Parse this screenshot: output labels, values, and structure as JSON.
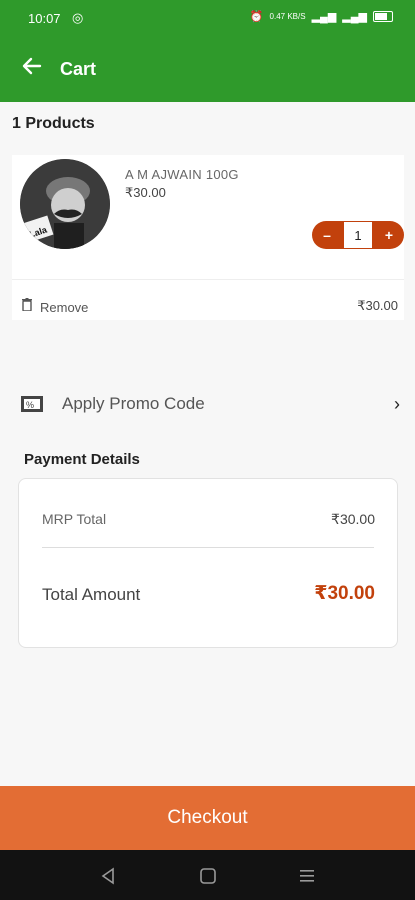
{
  "status_bar": {
    "time": "10:07",
    "net_speed": "0.47 KB/S"
  },
  "app_bar": {
    "title": "Cart",
    "back_icon": "arrow-left-icon"
  },
  "cart": {
    "products_count": "1 Products"
  },
  "product": {
    "name": "A M AJWAIN 100G",
    "price": "₹30.00",
    "quantity": "1",
    "minus": "–",
    "plus": "+",
    "remove_label": "Remove",
    "line_total": "₹30.00",
    "brand_logo": "Lala"
  },
  "promo": {
    "label": "Apply Promo Code",
    "icon": "promo-code-icon"
  },
  "payment": {
    "title": "Payment Details",
    "mrp_label": "MRP Total",
    "mrp_value": "₹30.00",
    "total_label": "Total Amount",
    "total_value": "₹30.00"
  },
  "checkout": {
    "label": "Checkout"
  },
  "colors": {
    "brand_green": "#2f9a2b",
    "accent_orange": "#c2410c",
    "checkout_orange": "#e36d34"
  }
}
